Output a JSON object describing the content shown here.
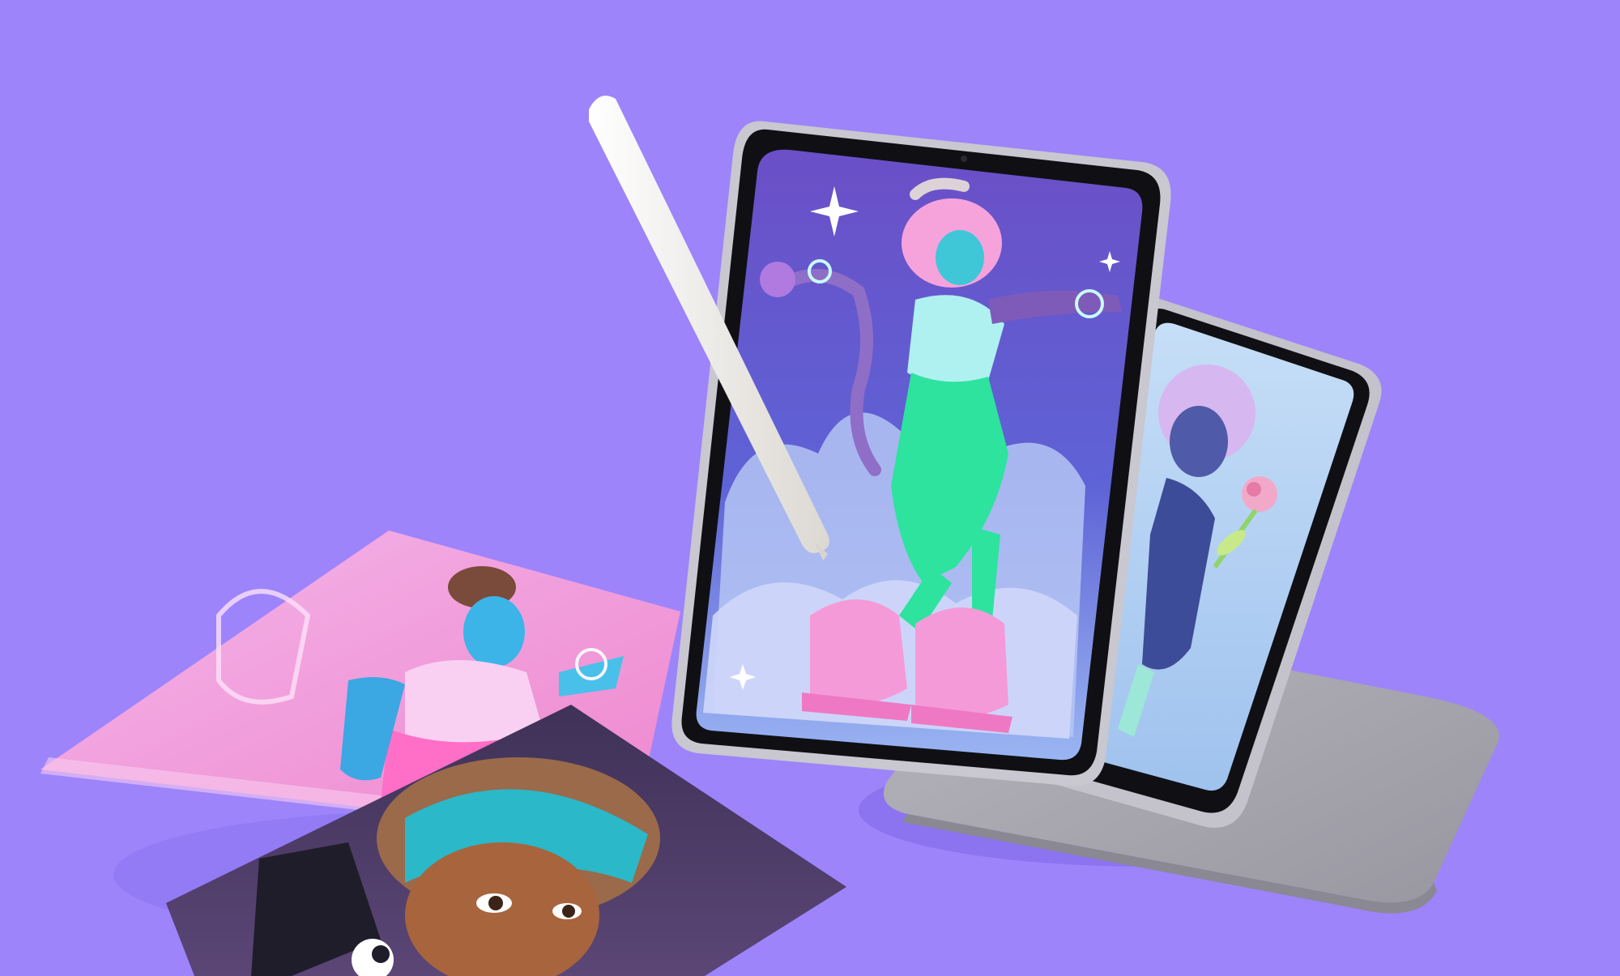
{
  "scene": {
    "background": "#9d84fb",
    "accent_shadow": "#7a63e6"
  },
  "objects": [
    {
      "name": "stylus-icon",
      "color": "#f3f1ee"
    },
    {
      "name": "tablet-front",
      "frame_color": "#c9c7cf",
      "bezel_color": "#101014",
      "screen_bg": "#5a56c9"
    },
    {
      "name": "tablet-middle",
      "frame_color": "#c4c2ca",
      "screen_bg": "#bcd4f3"
    },
    {
      "name": "tablet-back",
      "color": "#a9a7ae"
    },
    {
      "name": "print-pink",
      "color": "#f3a6df"
    },
    {
      "name": "print-dark",
      "color": "#4a3b66"
    }
  ]
}
